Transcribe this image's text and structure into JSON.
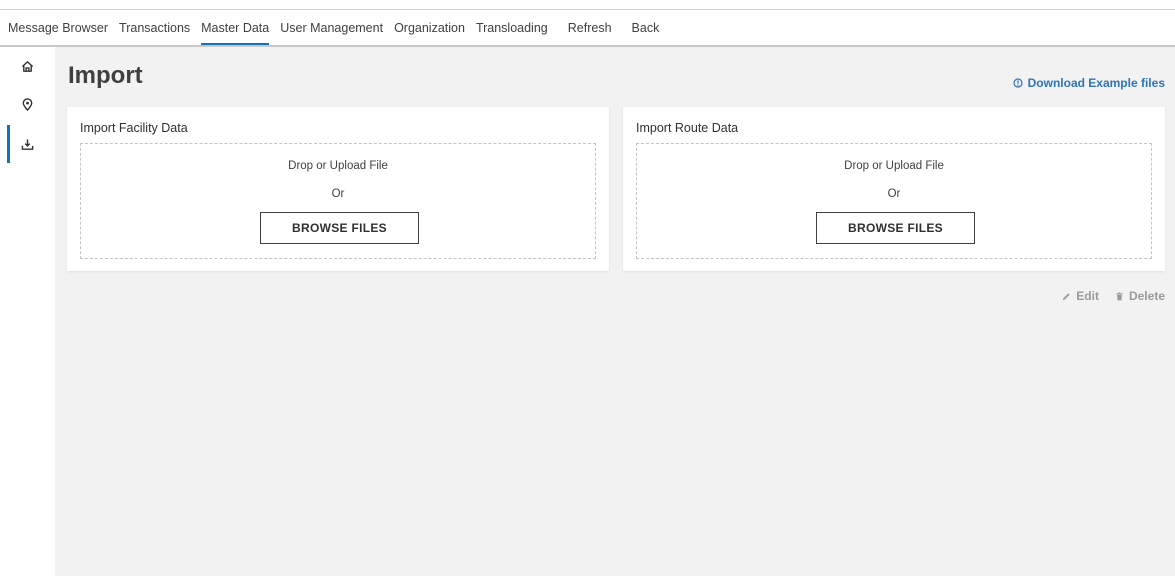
{
  "nav": {
    "items": [
      {
        "label": "Message Browser"
      },
      {
        "label": "Transactions"
      },
      {
        "label": "Master Data"
      },
      {
        "label": "User Management"
      },
      {
        "label": "Organization"
      },
      {
        "label": "Transloading"
      },
      {
        "label": "Refresh"
      },
      {
        "label": "Back"
      }
    ],
    "active": "Master Data"
  },
  "sidebar": {
    "items": [
      {
        "icon": "home-icon"
      },
      {
        "icon": "location-pin-icon"
      },
      {
        "icon": "import-icon",
        "active": true
      }
    ]
  },
  "page": {
    "title": "Import",
    "download_link": "Download Example files",
    "download_icon": "info-circle-icon"
  },
  "cards": [
    {
      "title": "Import Facility Data",
      "drop_text": "Drop or Upload File",
      "or_text": "Or",
      "browse_label": "BROWSE FILES"
    },
    {
      "title": "Import Route Data",
      "drop_text": "Drop or Upload File",
      "or_text": "Or",
      "browse_label": "BROWSE FILES"
    }
  ],
  "actions": {
    "edit_label": "Edit",
    "edit_icon": "pencil-icon",
    "delete_label": "Delete",
    "delete_icon": "trash-icon"
  },
  "colors": {
    "accent": "#1274b7",
    "link": "#2e74b5",
    "background": "#f2f2f2",
    "disabled": "#9a9a9a"
  }
}
